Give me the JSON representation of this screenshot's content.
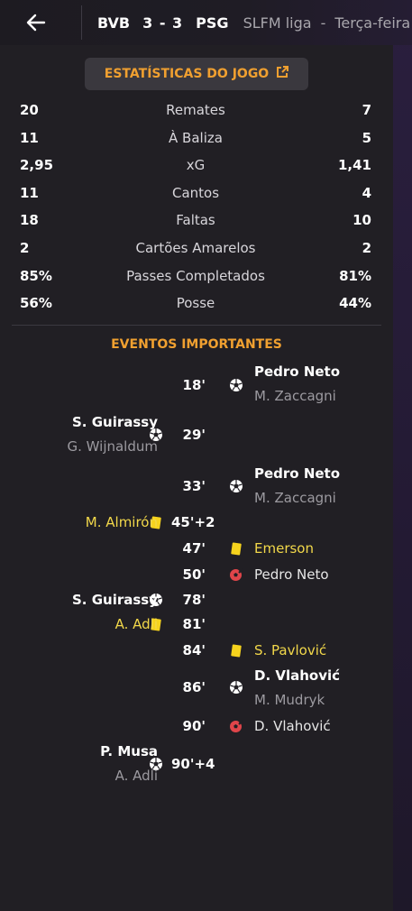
{
  "header": {
    "home_team": "BVB",
    "score": "3 - 3",
    "away_team": "PSG",
    "league": "SLFM liga",
    "separator": "-",
    "day": "Terça-feira"
  },
  "stats_button": {
    "label": "ESTATÍSTICAS DO JOGO"
  },
  "stats": [
    {
      "home": "20",
      "label": "Remates",
      "away": "7"
    },
    {
      "home": "11",
      "label": "À Baliza",
      "away": "5"
    },
    {
      "home": "2,95",
      "label": "xG",
      "away": "1,41"
    },
    {
      "home": "11",
      "label": "Cantos",
      "away": "4"
    },
    {
      "home": "18",
      "label": "Faltas",
      "away": "10"
    },
    {
      "home": "2",
      "label": "Cartões Amarelos",
      "away": "2"
    },
    {
      "home": "85%",
      "label": "Passes Completados",
      "away": "81%"
    },
    {
      "home": "56%",
      "label": "Posse",
      "away": "44%"
    }
  ],
  "events_title": "EVENTOS IMPORTANTES",
  "events": [
    {
      "minute": "18'",
      "side": "away",
      "type": "goal",
      "player": "Pedro Neto",
      "assist": "M. Zaccagni"
    },
    {
      "minute": "29'",
      "side": "home",
      "type": "goal",
      "player": "S. Guirassy",
      "assist": "G. Wijnaldum"
    },
    {
      "minute": "33'",
      "side": "away",
      "type": "goal",
      "player": "Pedro Neto",
      "assist": "M. Zaccagni"
    },
    {
      "minute": "45'+2",
      "side": "home",
      "type": "yellow",
      "player": "M. Almirón"
    },
    {
      "minute": "47'",
      "side": "away",
      "type": "yellow",
      "player": "Emerson"
    },
    {
      "minute": "50'",
      "side": "away",
      "type": "miss",
      "player": "Pedro Neto"
    },
    {
      "minute": "78'",
      "side": "home",
      "type": "goal",
      "player": "S. Guirassy"
    },
    {
      "minute": "81'",
      "side": "home",
      "type": "yellow",
      "player": "A. Adli"
    },
    {
      "minute": "84'",
      "side": "away",
      "type": "yellow",
      "player": "S. Pavlović"
    },
    {
      "minute": "86'",
      "side": "away",
      "type": "goal",
      "player": "D. Vlahović",
      "assist": "M. Mudryk"
    },
    {
      "minute": "90'",
      "side": "away",
      "type": "miss",
      "player": "D. Vlahović"
    },
    {
      "minute": "90'+4",
      "side": "home",
      "type": "goal",
      "player": "P. Musa",
      "assist": "A. Adli"
    }
  ],
  "colors": {
    "accent": "#f0a030",
    "yellow_card": "#f6d31d",
    "miss": "#e0454a"
  },
  "icons": {
    "back": "arrow-left-icon",
    "external": "external-link-icon",
    "goal": "soccer-ball-icon",
    "yellow": "yellow-card-icon",
    "miss": "missed-penalty-icon"
  }
}
